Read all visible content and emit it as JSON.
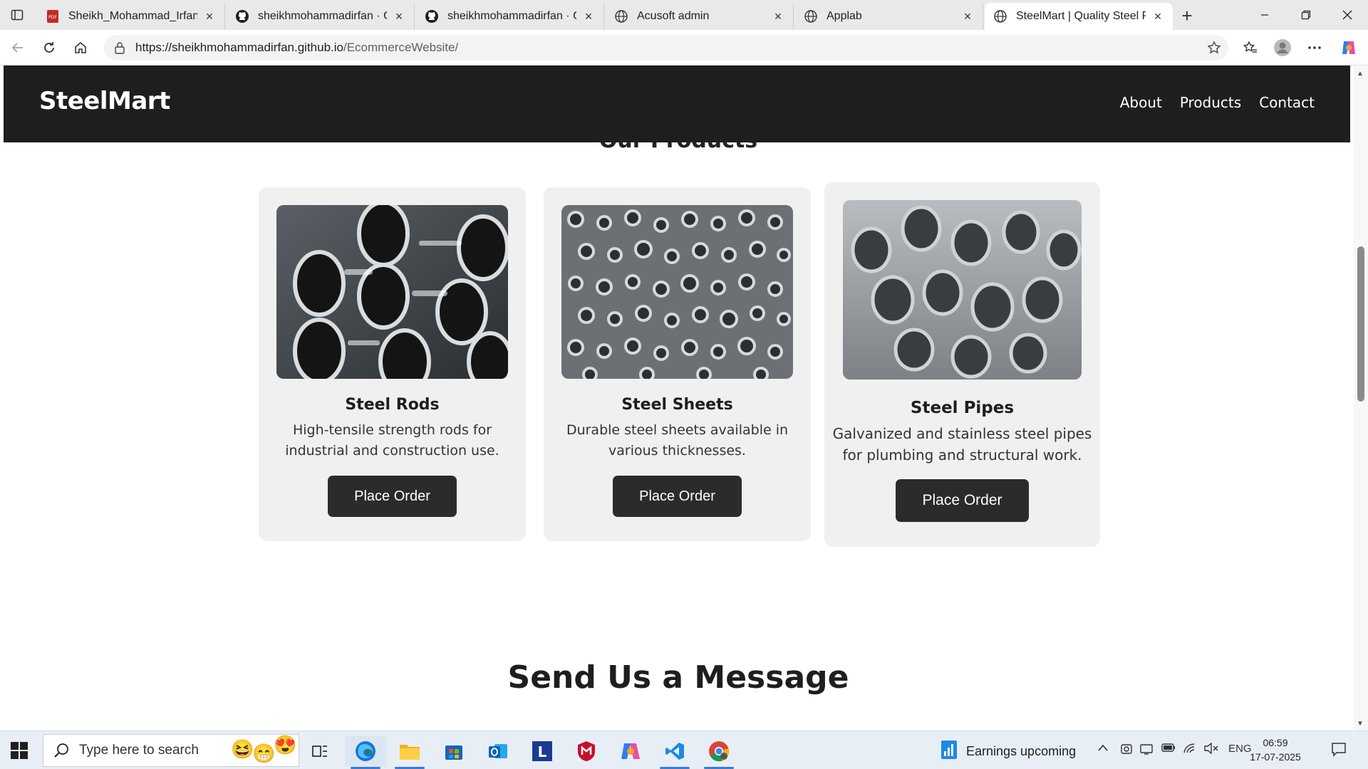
{
  "browser": {
    "tabs": [
      {
        "title": "Sheikh_Mohammad_Irfan_CS",
        "icon": "pdf-icon",
        "active": false
      },
      {
        "title": "sheikhmohammadirfan · GitH",
        "icon": "github-icon",
        "active": false
      },
      {
        "title": "sheikhmohammadirfan · GitH",
        "icon": "github-icon",
        "active": false
      },
      {
        "title": "Acusoft admin",
        "icon": "globe-icon",
        "active": false
      },
      {
        "title": "Applab",
        "icon": "globe-icon",
        "active": false
      },
      {
        "title": "SteelMart | Quality Steel Pro",
        "icon": "globe-icon",
        "active": true
      }
    ],
    "url_host": "https://sheikhmohammadirfan.github.io",
    "url_path": "/EcommerceWebsite/"
  },
  "site": {
    "brand": "SteelMart",
    "nav": [
      "About",
      "Products",
      "Contact"
    ],
    "products_heading": "Our Products",
    "products": [
      {
        "name": "Steel Rods",
        "desc_line1": "High-tensile strength rods for",
        "desc_line2": "industrial and construction use.",
        "button": "Place Order"
      },
      {
        "name": "Steel Sheets",
        "desc_line1": "Durable steel sheets available in",
        "desc_line2": "various thicknesses.",
        "button": "Place Order"
      },
      {
        "name": "Steel Pipes",
        "desc_line1": "Galvanized and stainless steel pipes",
        "desc_line2": "for plumbing and structural work.",
        "button": "Place Order"
      }
    ],
    "message_heading": "Send Us a Message"
  },
  "taskbar": {
    "search_placeholder": "Type here to search",
    "weather_text": "Earnings upcoming",
    "language": "ENG",
    "time": "06:59",
    "date": "17-07-2025"
  },
  "colors": {
    "header_bg": "#1e1e1e",
    "card_bg": "#f0f0f0",
    "button_bg": "#2b2b2b"
  }
}
